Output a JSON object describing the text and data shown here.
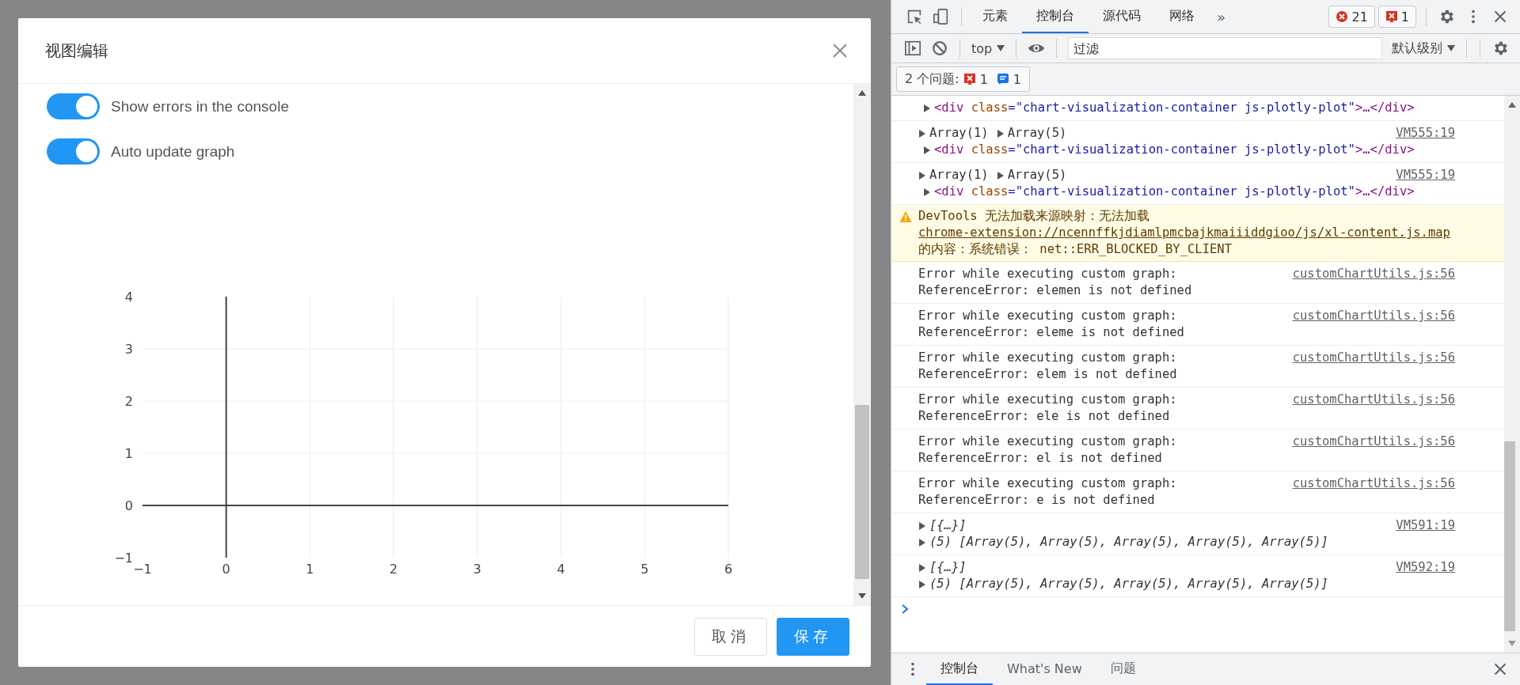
{
  "dialog": {
    "title": "视图编辑",
    "toggles": [
      {
        "label": "Show errors in the console",
        "on": true
      },
      {
        "label": "Auto update graph",
        "on": true
      }
    ],
    "chart_data": {
      "type": "line",
      "grid": true,
      "xlim": [
        -1,
        6
      ],
      "ylim": [
        -1,
        4
      ],
      "xticks": [
        {
          "value": -1,
          "label": "−1"
        },
        0,
        1,
        2,
        3,
        4,
        5,
        6
      ],
      "yticks": [
        {
          "value": -1,
          "label": "−1"
        },
        0,
        1,
        2,
        3,
        4
      ]
    },
    "buttons": [
      {
        "label": "取消",
        "kind": "secondary"
      },
      {
        "label": "保存",
        "kind": "primary"
      }
    ]
  },
  "devtools": {
    "tabs": [
      {
        "label": "元素",
        "selected": false
      },
      {
        "label": "控制台",
        "selected": true
      },
      {
        "label": "源代码",
        "selected": false
      },
      {
        "label": "网络",
        "selected": false
      }
    ],
    "overflow": "»",
    "error_count": "21",
    "issue_count": "1",
    "context": "top",
    "filter": {
      "placeholder": "过滤"
    },
    "level": "默认级别",
    "issues": {
      "label": "2 个问题:",
      "errors": "1",
      "messages": "1"
    },
    "console": [
      {
        "kind": "log",
        "lines": [
          {
            "kind": "element",
            "tokens": [
              {
                "kind": "tag",
                "text": "<div"
              },
              {
                "kind": "attr",
                "text": " class"
              },
              {
                "kind": "value",
                "text": "=\"chart-visualization-container js-plotly-plot\""
              },
              {
                "kind": "tag",
                "text": ">…</div>"
              }
            ]
          }
        ]
      },
      {
        "kind": "log",
        "source": "VM555:19",
        "lines": [
          {
            "kind": "objects",
            "italic": false,
            "items": [
              "Array(1)",
              "Array(5)"
            ]
          },
          {
            "kind": "element",
            "tokens": [
              {
                "kind": "tag",
                "text": "<div"
              },
              {
                "kind": "attr",
                "text": " class"
              },
              {
                "kind": "value",
                "text": "=\"chart-visualization-container js-plotly-plot\""
              },
              {
                "kind": "tag",
                "text": ">…</div>"
              }
            ]
          }
        ]
      },
      {
        "kind": "log",
        "source": "VM555:19",
        "lines": [
          {
            "kind": "objects",
            "italic": false,
            "items": [
              "Array(1)",
              "Array(5)"
            ]
          },
          {
            "kind": "element",
            "tokens": [
              {
                "kind": "tag",
                "text": "<div"
              },
              {
                "kind": "attr",
                "text": " class"
              },
              {
                "kind": "value",
                "text": "=\"chart-visualization-container js-plotly-plot\""
              },
              {
                "kind": "tag",
                "text": ">…</div>"
              }
            ]
          }
        ]
      },
      {
        "kind": "warning",
        "parts": [
          {
            "text": "DevTools 无法加载来源映射：无法加载 ",
            "link": false
          },
          {
            "text": "chrome-extension://ncennffkjdiamlpmcbajkmaiiiddgioo/js/xl-content.js.map",
            "link": true
          },
          {
            "text": " 的内容：系统错误： net::ERR_BLOCKED_BY_CLIENT",
            "link": false
          }
        ]
      },
      {
        "kind": "log",
        "source": "customChartUtils.js:56",
        "lines": [
          {
            "kind": "text",
            "text": "Error while executing custom graph:"
          },
          {
            "kind": "text",
            "text": "ReferenceError: elemen is not defined"
          }
        ]
      },
      {
        "kind": "log",
        "source": "customChartUtils.js:56",
        "lines": [
          {
            "kind": "text",
            "text": "Error while executing custom graph:"
          },
          {
            "kind": "text",
            "text": "ReferenceError: eleme is not defined"
          }
        ]
      },
      {
        "kind": "log",
        "source": "customChartUtils.js:56",
        "lines": [
          {
            "kind": "text",
            "text": "Error while executing custom graph:"
          },
          {
            "kind": "text",
            "text": "ReferenceError: elem is not defined"
          }
        ]
      },
      {
        "kind": "log",
        "source": "customChartUtils.js:56",
        "lines": [
          {
            "kind": "text",
            "text": "Error while executing custom graph:"
          },
          {
            "kind": "text",
            "text": "ReferenceError: ele is not defined"
          }
        ]
      },
      {
        "kind": "log",
        "source": "customChartUtils.js:56",
        "lines": [
          {
            "kind": "text",
            "text": "Error while executing custom graph:"
          },
          {
            "kind": "text",
            "text": "ReferenceError: el is not defined"
          }
        ]
      },
      {
        "kind": "log",
        "source": "customChartUtils.js:56",
        "lines": [
          {
            "kind": "text",
            "text": "Error while executing custom graph:"
          },
          {
            "kind": "text",
            "text": "ReferenceError: e is not defined"
          }
        ]
      },
      {
        "kind": "log",
        "source": "VM591:19",
        "lines": [
          {
            "kind": "objects",
            "italic": true,
            "items": [
              "[{…}]"
            ]
          },
          {
            "kind": "objects",
            "italic": true,
            "items": [
              "(5) [Array(5), Array(5), Array(5), Array(5), Array(5)]"
            ]
          }
        ]
      },
      {
        "kind": "log",
        "source": "VM592:19",
        "lines": [
          {
            "kind": "objects",
            "italic": true,
            "items": [
              "[{…}]"
            ]
          },
          {
            "kind": "objects",
            "italic": true,
            "items": [
              "(5) [Array(5), Array(5), Array(5), Array(5), Array(5)]"
            ]
          }
        ]
      }
    ],
    "drawer": {
      "tabs": [
        {
          "label": "控制台",
          "selected": true
        },
        {
          "label": "What's New",
          "selected": false
        },
        {
          "label": "问题",
          "selected": false
        }
      ]
    }
  }
}
